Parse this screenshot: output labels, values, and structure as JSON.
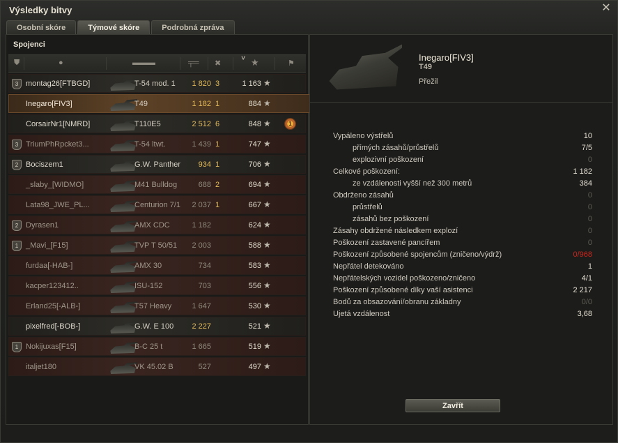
{
  "window": {
    "title": "Výsledky bitvy",
    "close_icon": "✕"
  },
  "tabs": [
    {
      "label": "Osobní skóre",
      "active": false
    },
    {
      "label": "Týmové skóre",
      "active": true
    },
    {
      "label": "Podrobná zpráva",
      "active": false
    }
  ],
  "team": {
    "title": "Spojenci",
    "columns": {
      "squad": "squad-icon",
      "player": "player-icon",
      "vehicle": "vehicle-icon",
      "damage": "damage-icon",
      "kills": "kills-icon",
      "xp": "xp-icon",
      "sort_arrow": "˅",
      "medals": "medal-icon"
    },
    "rows": [
      {
        "squad": "3",
        "name": "montag26[FTBGD]",
        "tank": "T-54 mod. 1",
        "damage": "1 820",
        "kills": "3",
        "xp": "1 163",
        "star": "★",
        "dead": false
      },
      {
        "squad": "",
        "name": "Inegaro[FIV3]",
        "tank": "T49",
        "damage": "1 182",
        "kills": "1",
        "xp": "884",
        "star": "★",
        "self": true,
        "dead": false
      },
      {
        "squad": "",
        "name": "CorsairNr1[NMRD]",
        "tank": "T110E5",
        "damage": "2 512",
        "kills": "6",
        "xp": "848",
        "star": "★",
        "medal": "1",
        "dead": false
      },
      {
        "squad": "3",
        "name": "TriumPhRpcket3...",
        "tank": "T-54 ltwt.",
        "damage": "1 439",
        "kills": "1",
        "xp": "747",
        "star": "★",
        "dead": true
      },
      {
        "squad": "2",
        "name": "Bociszem1",
        "tank": "G.W. Panther",
        "damage": "934",
        "kills": "1",
        "xp": "706",
        "star": "★",
        "dead": false
      },
      {
        "squad": "",
        "name": "_slaby_[WIDMO]",
        "tank": "M41 Bulldog",
        "damage": "688",
        "kills": "2",
        "xp": "694",
        "star": "★",
        "dead": true
      },
      {
        "squad": "",
        "name": "Lata98_JWE_PL...",
        "tank": "Centurion 7/1",
        "damage": "2 037",
        "kills": "1",
        "xp": "667",
        "star": "★",
        "dead": true
      },
      {
        "squad": "2",
        "name": "Dyrasen1",
        "tank": "AMX CDC",
        "damage": "1 182",
        "kills": "",
        "xp": "624",
        "star": "★",
        "dead": true
      },
      {
        "squad": "1",
        "name": "_Mavi_[F15]",
        "tank": "TVP T 50/51",
        "damage": "2 003",
        "kills": "",
        "xp": "588",
        "star": "★",
        "dead": true
      },
      {
        "squad": "",
        "name": "furdaa[-HAB-]",
        "tank": "AMX 30",
        "damage": "734",
        "kills": "",
        "xp": "583",
        "star": "★",
        "dead": true
      },
      {
        "squad": "",
        "name": "kacper123412..",
        "tank": "ISU-152",
        "damage": "703",
        "kills": "",
        "xp": "556",
        "star": "★",
        "dead": true
      },
      {
        "squad": "",
        "name": "Erland25[-ALB-]",
        "tank": "T57 Heavy",
        "damage": "1 647",
        "kills": "",
        "xp": "530",
        "star": "★",
        "dead": true
      },
      {
        "squad": "",
        "name": "pixelfred[-BOB-]",
        "tank": "G.W. E 100",
        "damage": "2 227",
        "kills": "",
        "xp": "521",
        "star": "★",
        "dead": false
      },
      {
        "squad": "1",
        "name": "Nokijuxas[F15]",
        "tank": "B-C 25 t",
        "damage": "1 665",
        "kills": "",
        "xp": "519",
        "star": "★",
        "dead": true
      },
      {
        "squad": "",
        "name": "italjet180",
        "tank": "VK 45.02 B",
        "damage": "527",
        "kills": "",
        "xp": "497",
        "star": "★",
        "dead": true
      }
    ]
  },
  "detail": {
    "player": "Inegaro[FIV3]",
    "tank": "T49",
    "status": "Přežil",
    "stats": [
      {
        "label": "Vypáleno výstřelů",
        "value": "10",
        "sub": false,
        "style": ""
      },
      {
        "label": "přímých zásahů/průstřelů",
        "value": "7/5",
        "sub": true,
        "style": ""
      },
      {
        "label": "explozivní poškození",
        "value": "0",
        "sub": true,
        "style": "zero"
      },
      {
        "label": "Celkové poškození:",
        "value": "1 182",
        "sub": false,
        "style": ""
      },
      {
        "label": "ze vzdálenosti vyšší než 300 metrů",
        "value": "384",
        "sub": true,
        "style": ""
      },
      {
        "label": "Obdrženo zásahů",
        "value": "0",
        "sub": false,
        "style": "zero"
      },
      {
        "label": "průstřelů",
        "value": "0",
        "sub": true,
        "style": "zero"
      },
      {
        "label": "zásahů bez poškození",
        "value": "0",
        "sub": true,
        "style": "zero"
      },
      {
        "label": "Zásahy obdržené následkem explozí",
        "value": "0",
        "sub": false,
        "style": "zero"
      },
      {
        "label": "Poškození zastavené pancířem",
        "value": "0",
        "sub": false,
        "style": "zero"
      },
      {
        "label": "Poškození způsobené spojencům (zničeno/výdrž)",
        "value": "0/968",
        "sub": false,
        "style": "red"
      },
      {
        "label": "Nepřátel detekováno",
        "value": "1",
        "sub": false,
        "style": ""
      },
      {
        "label": "Nepřátelských vozidel poškozeno/zničeno",
        "value": "4/1",
        "sub": false,
        "style": ""
      },
      {
        "label": "Poškození způsobené díky vaší asistenci",
        "value": "2 217",
        "sub": false,
        "style": ""
      },
      {
        "label": "Bodů za obsazování/obranu základny",
        "value": "0/0",
        "sub": false,
        "style": "zero"
      },
      {
        "label": "Ujetá vzdálenost",
        "value": "3,68",
        "sub": false,
        "style": ""
      }
    ],
    "close_button": "Zavřít"
  }
}
